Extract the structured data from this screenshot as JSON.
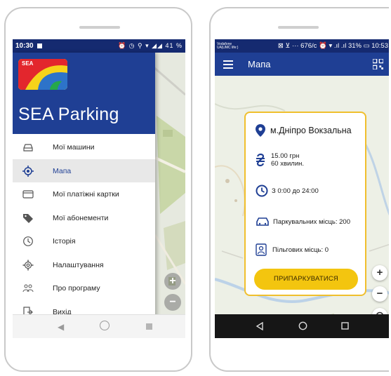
{
  "left_phone": {
    "status": {
      "time": "10:30",
      "battery": "41 %",
      "icons": "⏰ ◷ ⚲ ▾ ◢◢"
    },
    "drawer": {
      "logo_text": "SEA",
      "title": "SEA Parking",
      "items": [
        {
          "label": "Мої машини",
          "icon": "car-icon"
        },
        {
          "label": "Мапа",
          "icon": "location-target-icon",
          "active": true
        },
        {
          "label": "Мої платіжні картки",
          "icon": "credit-card-icon"
        },
        {
          "label": "Мої абонементи",
          "icon": "tag-icon"
        },
        {
          "label": "Історія",
          "icon": "history-icon"
        },
        {
          "label": "Налаштування",
          "icon": "gear-icon"
        },
        {
          "label": "Про програму",
          "icon": "people-icon"
        },
        {
          "label": "Вихід",
          "icon": "exit-icon"
        }
      ]
    },
    "zoom_in": "+",
    "zoom_out": "−"
  },
  "right_phone": {
    "status": {
      "carrier": "Vodafone UA|UMC life:)",
      "rest": "⊠ ⊻ ··· 676/с ⏰ ▾ .ıl .ıl 31% ▭ 10:53"
    },
    "toolbar": {
      "title": "Мапа"
    },
    "card": {
      "station": "м.Дніпро Вокзальна",
      "price": "15.00 грн",
      "duration": "60 хвилин.",
      "hours": "З 0:00 до 24:00",
      "parking_spaces": "Паркувальних місць: 200",
      "privileged_spaces": "Пільгових місць: 0",
      "cta": "ПРИПАРКУВАТИСЯ"
    },
    "zoom_in": "+",
    "zoom_out": "−"
  },
  "colors": {
    "brand_blue": "#1f3f94",
    "status_blue": "#152a70",
    "accent_yellow": "#f3c50f",
    "card_border": "#f0bf2d"
  }
}
